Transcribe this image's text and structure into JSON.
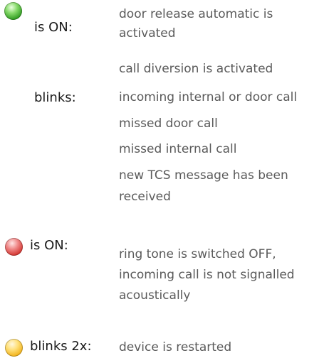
{
  "colors": {
    "green_led": "#2e9a1f",
    "red_led": "#d3342f",
    "yellow_led": "#f2b21a",
    "state_text": "#1a1a1a",
    "description_text": "#5a5a5a"
  },
  "blocks": [
    {
      "led": "green-led-icon",
      "states": [
        {
          "label": "is ON:",
          "descriptions": [
            "door release automatic is",
            "activated",
            "call diversion is activated"
          ]
        },
        {
          "label": "blinks:",
          "descriptions": [
            "incoming internal or door call",
            "missed door call",
            "missed internal call",
            "new TCS message has been",
            "received"
          ]
        }
      ]
    },
    {
      "led": "red-led-icon",
      "states": [
        {
          "label": "is ON:",
          "descriptions": [
            "ring tone is switched OFF,",
            "incoming call is not signalled",
            "acoustically"
          ]
        }
      ]
    },
    {
      "led": "yellow-led-icon",
      "states": [
        {
          "label": "blinks 2x:",
          "descriptions": [
            "device is restarted"
          ]
        }
      ]
    }
  ]
}
